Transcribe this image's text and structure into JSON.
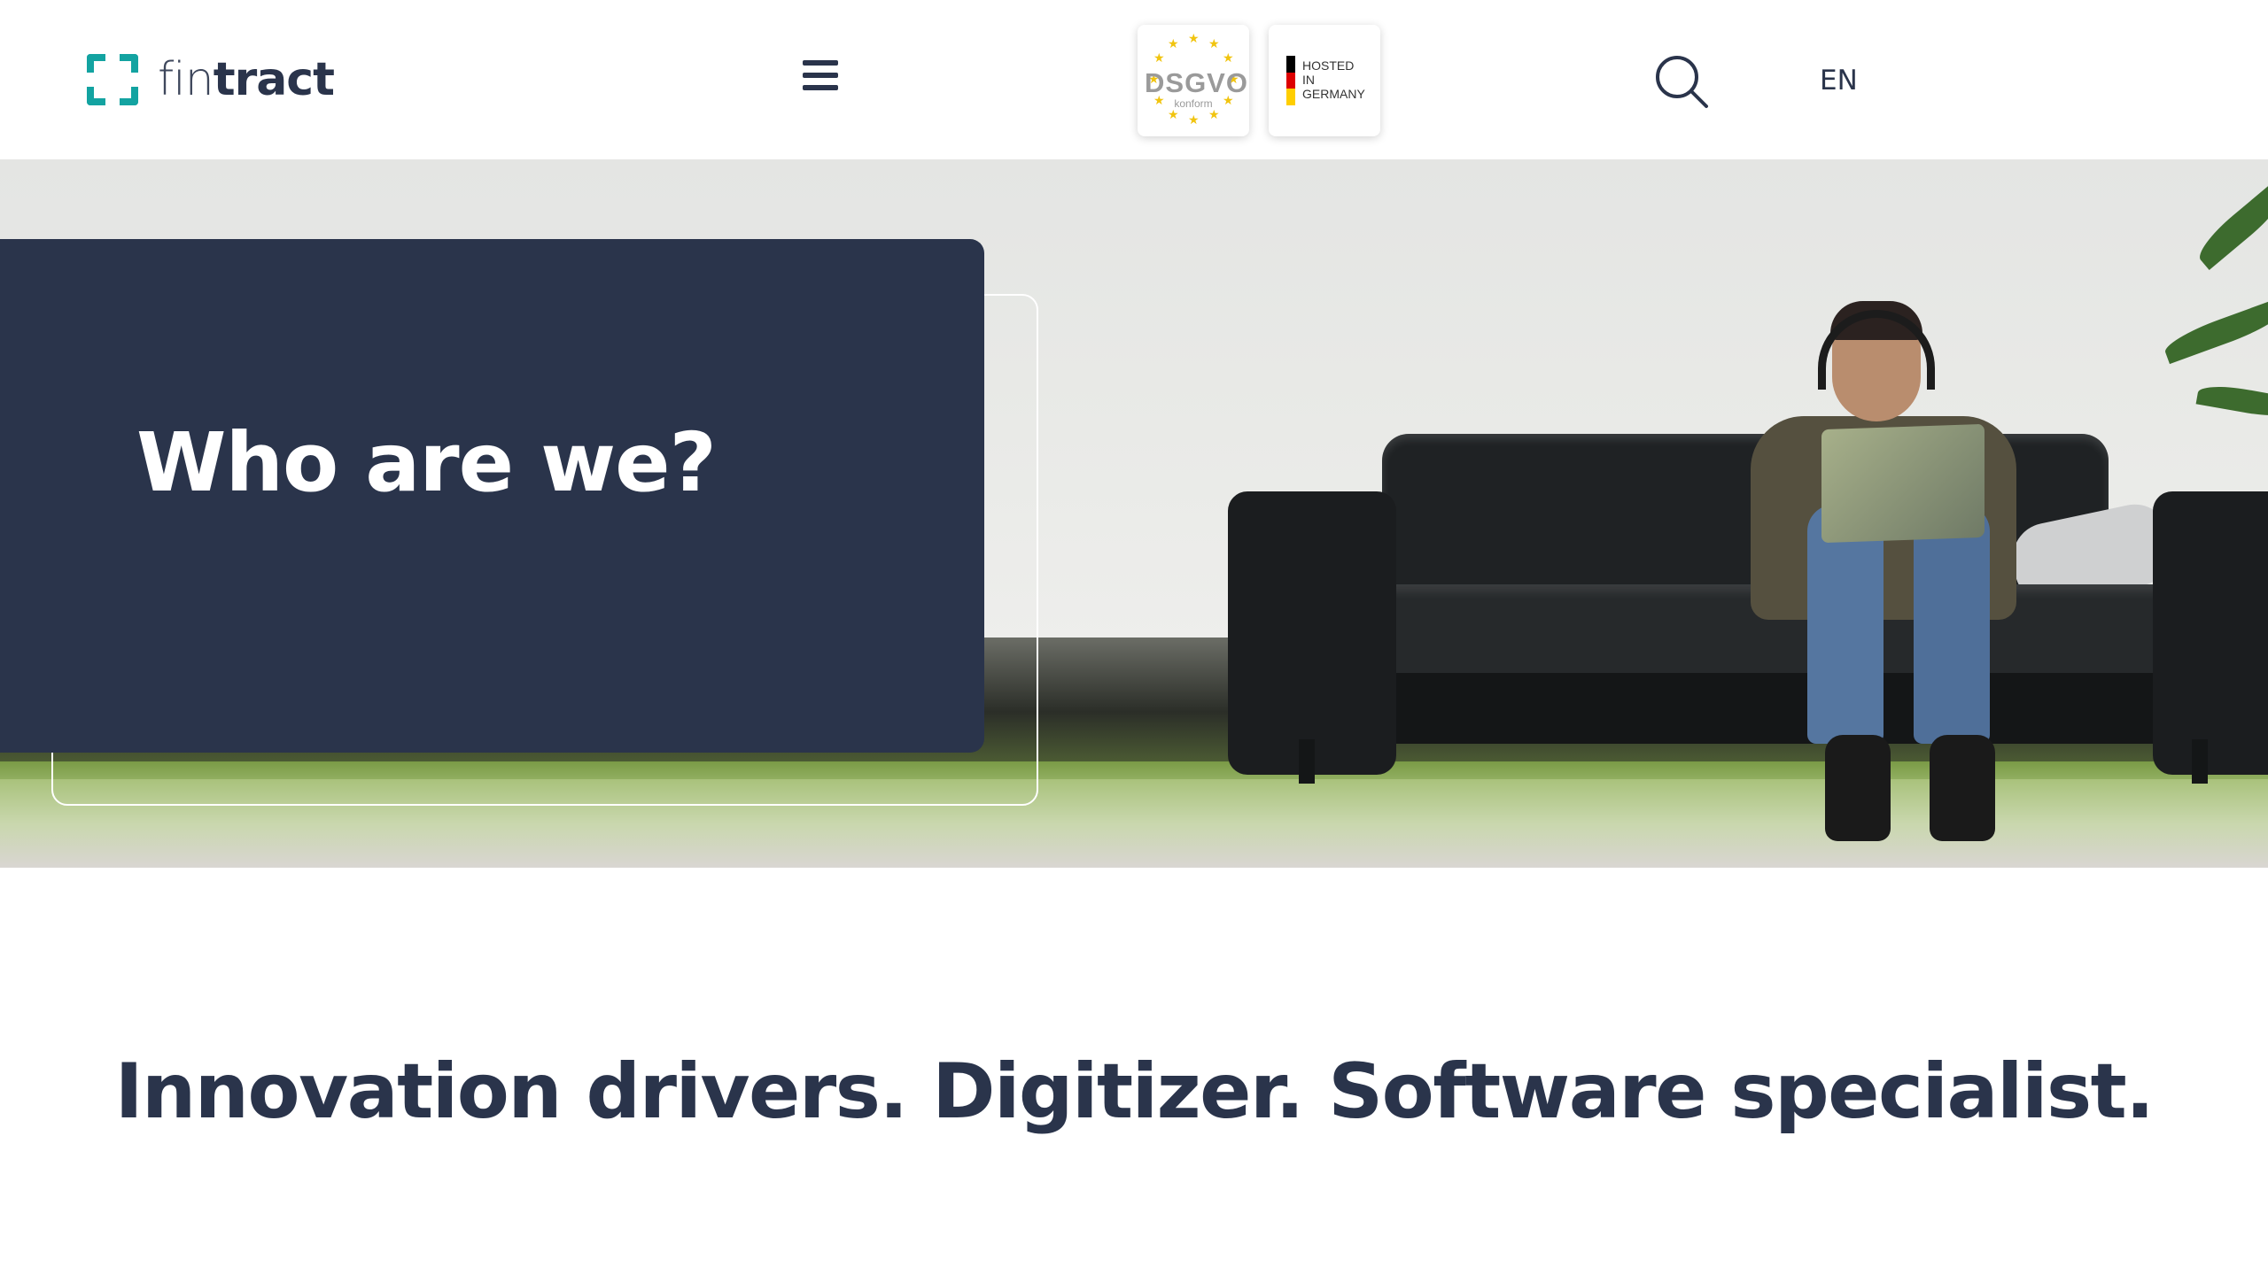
{
  "header": {
    "brand": {
      "part1": "fin",
      "part2": "tract",
      "accent_color": "#13a3a1",
      "text_color": "#2a344b"
    },
    "menu_icon": "hamburger-icon",
    "badges": {
      "dsgvo": {
        "main": "DSGVO",
        "sub": "konform"
      },
      "hosted": {
        "lines": [
          "HOSTED",
          "IN",
          "GERMANY"
        ],
        "flag_colors": [
          "#000000",
          "#dd0000",
          "#ffce00"
        ]
      }
    },
    "search_icon": "search-icon",
    "language": "EN"
  },
  "hero": {
    "title": "Who are we?",
    "card_color": "#2a344b"
  },
  "tagline": "Innovation drivers. Digitizer. Software specialist."
}
